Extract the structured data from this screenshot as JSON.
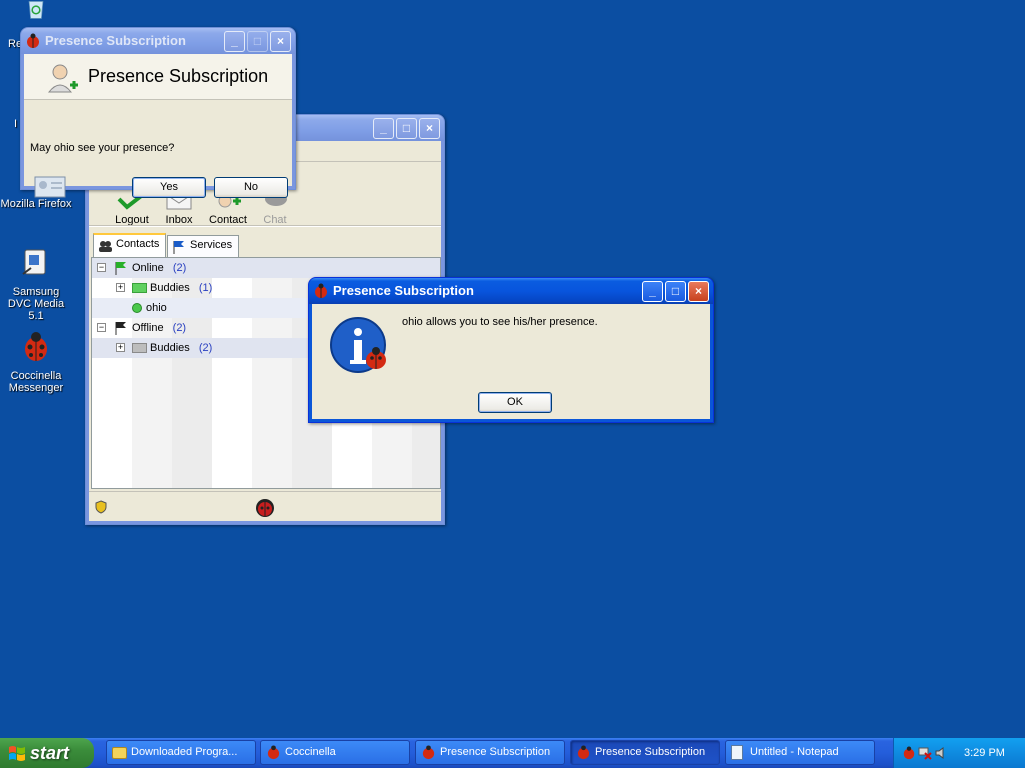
{
  "desktop": {
    "icons": [
      {
        "label": "Re"
      },
      {
        "label": "I"
      },
      {
        "label": "Mozilla Firefox"
      },
      {
        "label": "Samsung DVC Media 5.1"
      },
      {
        "label": "Coccinella Messenger"
      }
    ]
  },
  "request_dialog": {
    "title": "Presence Subscription",
    "heading": "Presence Subscription",
    "question": "May ohio see your presence?",
    "yes_label": "Yes",
    "no_label": "No"
  },
  "main_window": {
    "toolbar": {
      "logout": "Logout",
      "inbox": "Inbox",
      "contact": "Contact",
      "chat": "Chat"
    },
    "tabs": {
      "contacts": "Contacts",
      "services": "Services"
    },
    "tree": {
      "online_label": "Online",
      "online_count": "(2)",
      "buddies_online_label": "Buddies",
      "buddies_online_count": "(1)",
      "contact_ohio": "ohio",
      "offline_label": "Offline",
      "offline_count": "(2)",
      "buddies_offline_label": "Buddies",
      "buddies_offline_count": "(2)"
    }
  },
  "info_dialog": {
    "title": "Presence Subscription",
    "message": "ohio allows you to see his/her presence.",
    "ok_label": "OK"
  },
  "taskbar": {
    "start_label": "start",
    "items": [
      {
        "label": "Downloaded Progra..."
      },
      {
        "label": "Coccinella"
      },
      {
        "label": "Presence Subscription"
      },
      {
        "label": "Presence Subscription"
      },
      {
        "label": "Untitled - Notepad"
      }
    ],
    "clock": "3:29 PM"
  },
  "colors": {
    "desktop": "#0b4ea2",
    "title_active": "#0855dd",
    "dialog_face": "#ece9d8",
    "link_count": "#2a40c0"
  }
}
